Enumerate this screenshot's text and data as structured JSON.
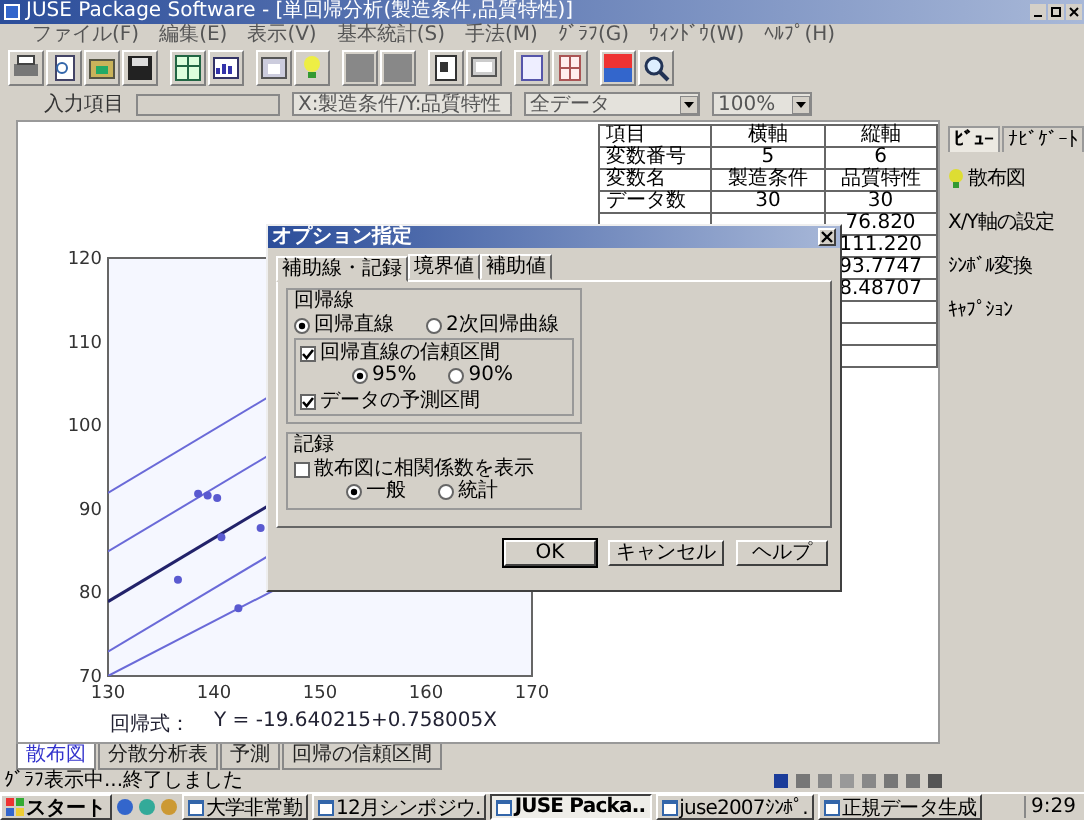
{
  "window": {
    "title": "JUSE Package Software - [単回帰分析(製造条件,品質特性)]"
  },
  "menu": [
    "ファイル(F)",
    "編集(E)",
    "表示(V)",
    "基本統計(S)",
    "手法(M)",
    "ｸﾞﾗﾌ(G)",
    "ｳｨﾝﾄﾞｳ(W)",
    "ﾍﾙﾌﾟ(H)"
  ],
  "input_bar": {
    "label": "入力項目",
    "combos": [
      "X:製造条件/Y:品質特性",
      "全データ",
      "100%"
    ]
  },
  "table": {
    "rows": [
      {
        "column_1": "項目",
        "column_2": "横軸",
        "column_3": "縦軸"
      },
      {
        "column_1": "変数番号",
        "column_2": "5",
        "column_3": "6"
      },
      {
        "column_1": "変数名",
        "column_2": "製造条件",
        "column_3": "品質特性"
      },
      {
        "column_1": "データ数",
        "column_2": "30",
        "column_3": "30"
      },
      {
        "column_3": "76.820"
      },
      {
        "column_3": "111.220"
      },
      {
        "column_3": "93.7747"
      },
      {
        "column_3": "8.48707"
      }
    ]
  },
  "chart_data": {
    "type": "scatter",
    "xlim": [
      130,
      170
    ],
    "ylim": [
      70,
      120
    ],
    "xticks": [
      130,
      140,
      150,
      160,
      170
    ],
    "yticks": [
      70,
      80,
      90,
      100,
      110,
      120
    ],
    "x": [
      138.5,
      139.4,
      140.3,
      140.7,
      144.4,
      136.6,
      142.3
    ],
    "series": [
      {
        "color": "#5a5ad0",
        "values": [
          91.8,
          91.6,
          91.3,
          86.6,
          87.7,
          81.5,
          78.1
        ]
      }
    ]
  },
  "formula": {
    "label": "回帰式：",
    "equation": "Y = -19.640215+0.758005X"
  },
  "dialog": {
    "title": "オプション指定",
    "tabs": [
      {
        "label": "補助線・記録",
        "selected": true
      },
      {
        "label": "境界値",
        "selected": false
      },
      {
        "label": "補助値",
        "selected": false
      }
    ],
    "groups": [
      {
        "title": "回帰線",
        "items": [
          {
            "kind": "radio_row",
            "options": [
              {
                "label": "回帰直線",
                "selected": true
              },
              {
                "label": "2次回帰曲線",
                "selected": false
              }
            ]
          },
          {
            "kind": "box",
            "items": [
              {
                "kind": "checkbox",
                "label": "回帰直線の信頼区間",
                "checked": true,
                "options": [
                  {
                    "label": "95%",
                    "selected": true
                  },
                  {
                    "label": "90%",
                    "selected": false
                  }
                ]
              },
              {
                "kind": "checkbox",
                "label": "データの予測区間",
                "checked": true
              }
            ]
          }
        ]
      },
      {
        "title": "記録",
        "items": [
          {
            "kind": "checkbox",
            "label": "散布図に相関係数を表示",
            "checked": false,
            "options": [
              {
                "label": "一般",
                "selected": true
              },
              {
                "label": "統計",
                "selected": false
              }
            ]
          }
        ]
      }
    ],
    "buttons": [
      "OK",
      "キャンセル",
      "ヘルプ"
    ]
  },
  "side_panel": {
    "tabs": [
      {
        "label": "ﾋﾞｭｰ",
        "selected": true
      },
      {
        "label": "ﾅﾋﾞｹﾞｰﾄ",
        "selected": false
      }
    ],
    "items": [
      "散布図",
      "X/Y軸の設定",
      "ｼﾝﾎﾞﾙ変換",
      "ｷｬﾌﾟｼｮﾝ"
    ]
  },
  "bottom_tabs": [
    {
      "label": "散布図",
      "selected": true
    },
    {
      "label": "分散分析表",
      "selected": false
    },
    {
      "label": "予測",
      "selected": false
    },
    {
      "label": "回帰の信頼区間",
      "selected": false
    }
  ],
  "status_bar": "ｸﾞﾗﾌ表示中...終了しました",
  "taskbar": {
    "start": "スタート",
    "tasks": [
      {
        "label": "大学非常勤",
        "selected": false
      },
      {
        "label": "12月シンポジウ.",
        "selected": false
      },
      {
        "label": "JUSE Packa..",
        "selected": true
      },
      {
        "label": "juse2007ｼﾝﾎﾟ.",
        "selected": false
      },
      {
        "label": "正規データ生成",
        "selected": false
      }
    ],
    "clock": "9:29"
  }
}
